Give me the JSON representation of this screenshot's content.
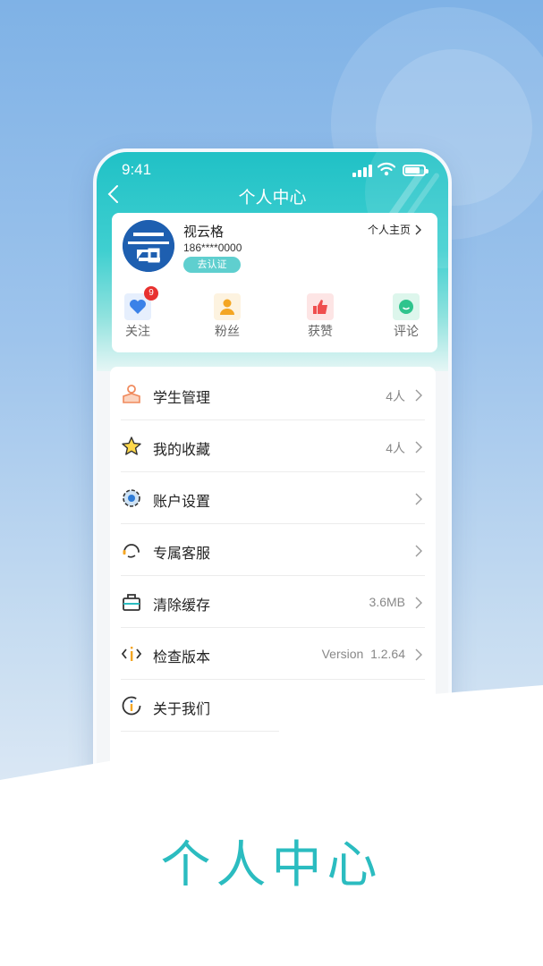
{
  "status_bar": {
    "time": "9:41"
  },
  "nav": {
    "title": "个人中心"
  },
  "profile": {
    "name": "视云格",
    "phone": "186****0000",
    "verify_label": "去认证",
    "homepage_label": "个人主页"
  },
  "stats": [
    {
      "label": "关注",
      "icon": "heart-icon",
      "badge": "9",
      "color": "#3b82e8"
    },
    {
      "label": "粉丝",
      "icon": "person-icon",
      "color": "#f4a623"
    },
    {
      "label": "获赞",
      "icon": "thumbs-up-icon",
      "color": "#ef4f4f"
    },
    {
      "label": "评论",
      "icon": "comment-icon",
      "color": "#2fc48d"
    }
  ],
  "menu": [
    {
      "label": "学生管理",
      "value": "4人",
      "icon": "student-icon"
    },
    {
      "label": "我的收藏",
      "value": "4人",
      "icon": "star-icon"
    },
    {
      "label": "账户设置",
      "value": "",
      "icon": "gear-icon"
    },
    {
      "label": "专属客服",
      "value": "",
      "icon": "headset-icon"
    },
    {
      "label": "清除缓存",
      "value": "3.6MB",
      "icon": "toolbox-icon"
    },
    {
      "label": "检查版本",
      "value": "Version  1.2.64",
      "icon": "code-info-icon"
    },
    {
      "label": "关于我们",
      "value": "",
      "icon": "info-icon"
    }
  ],
  "slogan": "个人中心",
  "colors": {
    "accent": "#2bbcc0",
    "header": "#20c1c6",
    "badge": "#e8312f"
  }
}
